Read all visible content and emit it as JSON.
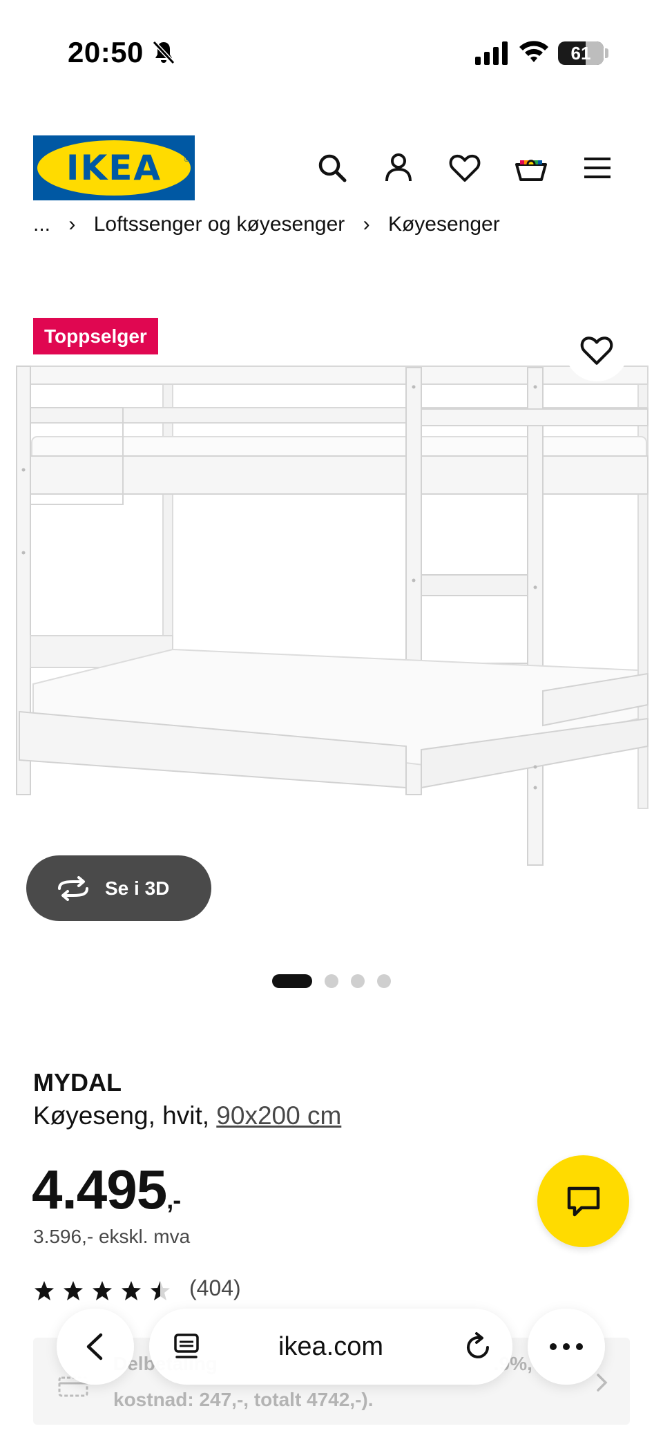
{
  "status_bar": {
    "time": "20:50",
    "battery": "61",
    "icons": [
      "bell-slash-icon",
      "cellular-signal-icon",
      "wifi-icon",
      "battery-icon"
    ]
  },
  "header": {
    "logo_text": "IKEA",
    "icons": [
      "search-icon",
      "account-icon",
      "heart-icon",
      "cart-icon",
      "menu-icon"
    ]
  },
  "breadcrumb": {
    "items": [
      "...",
      "Loftssenger og køyesenger",
      "Køyesenger"
    ]
  },
  "product_image": {
    "badge": "Toppselger",
    "view_3d_label": "Se i 3D",
    "carousel": {
      "count": 4,
      "active": 0
    }
  },
  "product": {
    "name": "MYDAL",
    "description": "Køyeseng, hvit,",
    "size": "90x200 cm",
    "price": "4.495",
    "price_suffix": ",-",
    "ex_vat": "3.596,- ekskl. mva",
    "rating": 4.5,
    "review_count": "(404)"
  },
  "financing": {
    "line1": "Delbetaling",
    "line1_end": ".9%,",
    "line2": "kostnad: 247,-, totalt 4742,-)."
  },
  "browser": {
    "url": "ikea.com"
  },
  "colors": {
    "ikea_blue": "#0058a3",
    "ikea_yellow": "#ffdb00",
    "badge_pink": "#e00751",
    "dark_button": "#4a4a4a"
  }
}
